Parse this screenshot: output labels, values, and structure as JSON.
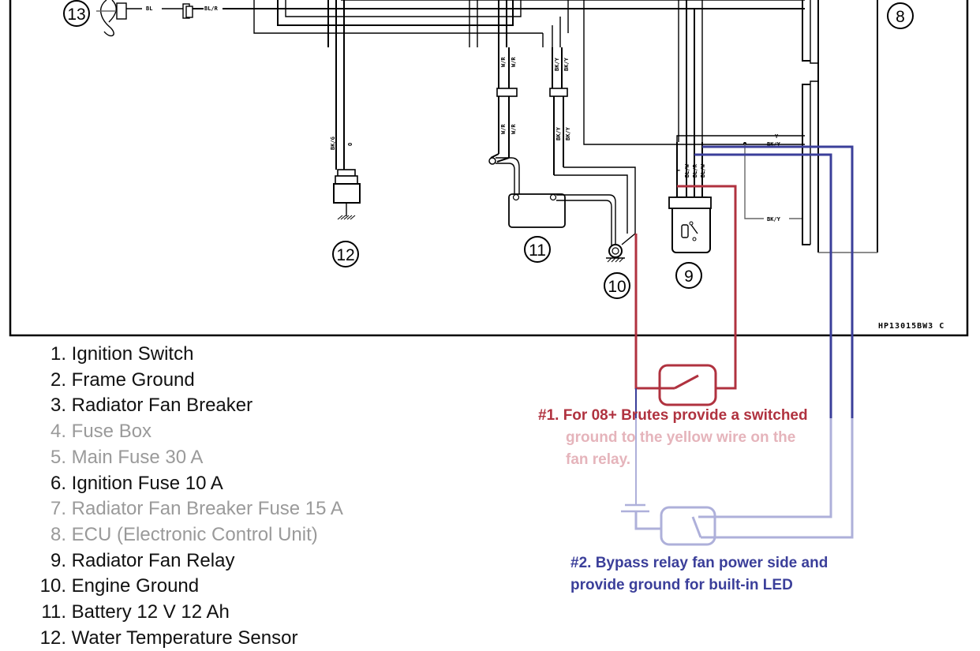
{
  "diagram": {
    "drawing_code": "HP13015BW3  C",
    "component_callouts": [
      "13",
      "12",
      "11",
      "10",
      "9",
      "8"
    ],
    "wire_labels": {
      "fan_left": "BL",
      "fan_right": "BL/R",
      "battery_pos_upper": [
        "W/R",
        "W/R"
      ],
      "battery_pos_lower": [
        "W/R",
        "W/R"
      ],
      "battery_neg_upper": [
        "BK/Y",
        "BK/Y"
      ],
      "battery_neg_lower": [
        "BK/Y",
        "BK/Y"
      ],
      "sensor": [
        "BK/G",
        "O"
      ],
      "relay_pins": [
        "Y",
        "BL/W",
        "BL/R",
        "BL/W"
      ],
      "ecu_top": [
        "Y",
        "BK/Y"
      ],
      "ecu_bottom": "BK/Y"
    },
    "colors": {
      "mod1": "#b0323f",
      "mod1_faded": "#e5b4bb",
      "mod2": "#3b3f9a",
      "mod2_faded": "#aeb0da"
    }
  },
  "legend": {
    "items": [
      {
        "num": "1.",
        "label": "Ignition Switch",
        "faded": false
      },
      {
        "num": "2.",
        "label": "Frame Ground",
        "faded": false
      },
      {
        "num": "3.",
        "label": "Radiator Fan Breaker",
        "faded": false
      },
      {
        "num": "4.",
        "label": "Fuse Box",
        "faded": true
      },
      {
        "num": "5.",
        "label": "Main Fuse 30 A",
        "faded": true
      },
      {
        "num": "6.",
        "label": "Ignition Fuse 10 A",
        "faded": false
      },
      {
        "num": "7.",
        "label": "Radiator Fan Breaker Fuse 15 A",
        "faded": true
      },
      {
        "num": "8.",
        "label": "ECU (Electronic Control Unit)",
        "faded": true
      },
      {
        "num": "9.",
        "label": "Radiator Fan Relay",
        "faded": false
      },
      {
        "num": "10.",
        "label": "Engine Ground",
        "faded": false
      },
      {
        "num": "11.",
        "label": "Battery 12 V 12 Ah",
        "faded": false
      },
      {
        "num": "12.",
        "label": "Water Temperature Sensor",
        "faded": false
      }
    ]
  },
  "notes": {
    "note1": {
      "line1": "#1. For 08+ Brutes provide a switched",
      "line2": "ground to the yellow wire on the",
      "line3": "fan relay."
    },
    "note2": {
      "line1": "#2. Bypass relay fan power side and",
      "line2": "provide ground for built-in LED"
    }
  }
}
